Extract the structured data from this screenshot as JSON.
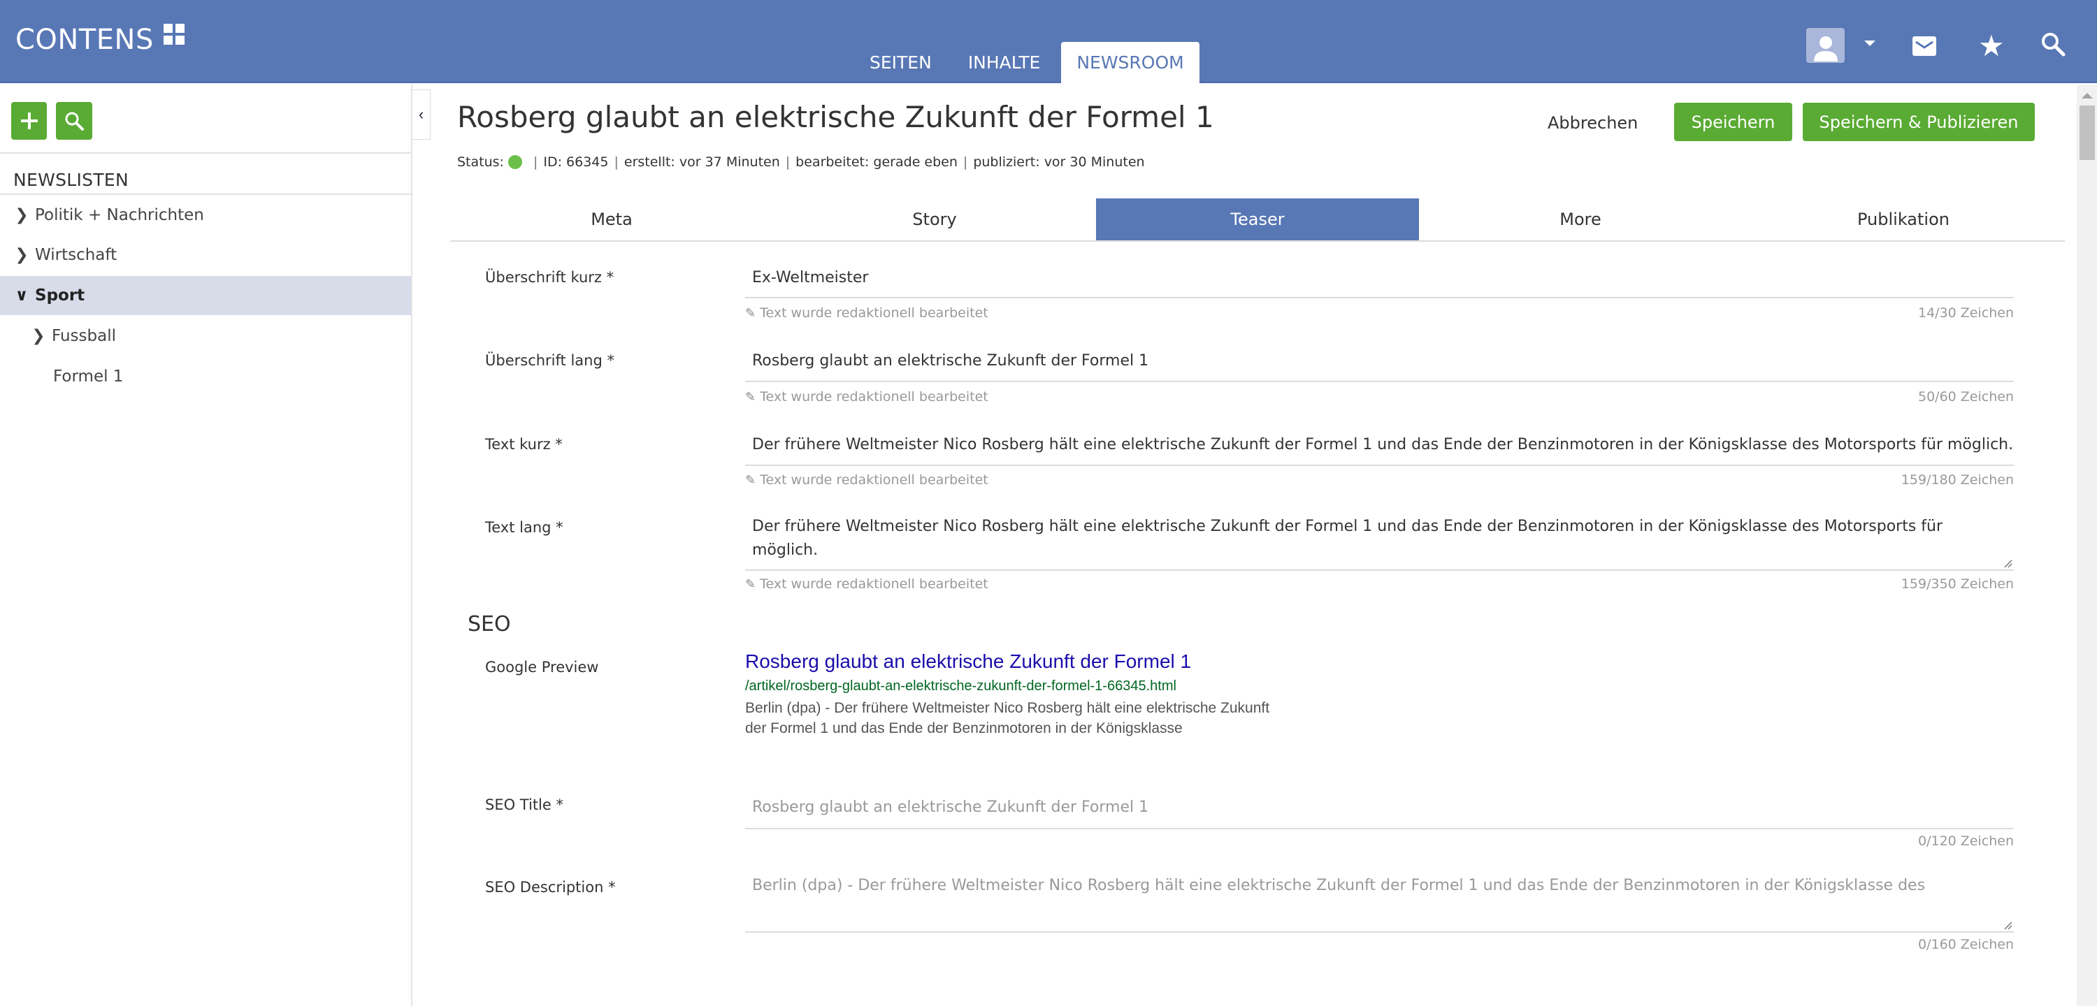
{
  "app": {
    "logo": "CONTENS",
    "main_tabs": [
      {
        "label": "SEITEN",
        "active": false
      },
      {
        "label": "INHALTE",
        "active": false
      },
      {
        "label": "NEWSROOM",
        "active": true
      }
    ],
    "icons": [
      "user-avatar-icon",
      "caret-down-icon",
      "mail-icon",
      "star-icon",
      "search-icon"
    ]
  },
  "sidebar": {
    "heading": "NEWSLISTEN",
    "items": [
      {
        "label": "Politik + Nachrichten",
        "icon": "chevron-right",
        "level": 0,
        "selected": false
      },
      {
        "label": "Wirtschaft",
        "icon": "chevron-right",
        "level": 0,
        "selected": false
      },
      {
        "label": "Sport",
        "icon": "chevron-down",
        "level": 0,
        "selected": true
      },
      {
        "label": "Fussball",
        "icon": "chevron-right",
        "level": 1,
        "selected": false
      },
      {
        "label": "Formel 1",
        "icon": "",
        "level": 1,
        "selected": false
      }
    ]
  },
  "article": {
    "title": "Rosberg glaubt an elektrische Zukunft der Formel 1",
    "status_label": "Status:",
    "status_color": "#6cc04a",
    "id": "ID: 66345",
    "created": "erstellt: vor 37 Minuten",
    "edited": "bearbeitet: gerade eben",
    "published": "publiziert: vor 30 Minuten"
  },
  "actions": {
    "cancel": "Abbrechen",
    "save": "Speichern",
    "save_publish": "Speichern & Publizieren"
  },
  "tabs": [
    {
      "label": "Meta",
      "active": false
    },
    {
      "label": "Story",
      "active": false
    },
    {
      "label": "Teaser",
      "active": true
    },
    {
      "label": "More",
      "active": false
    },
    {
      "label": "Publikation",
      "active": false
    }
  ],
  "fields": [
    {
      "label": "Überschrift kurz *",
      "value": "Ex-Weltmeister",
      "hint": "Text wurde redaktionell bearbeitet",
      "counter": "14/30 Zeichen"
    },
    {
      "label": "Überschrift lang *",
      "value": "Rosberg glaubt an elektrische Zukunft der Formel 1",
      "hint": "Text wurde redaktionell bearbeitet",
      "counter": "50/60 Zeichen"
    },
    {
      "label": "Text kurz *",
      "value": "Der frühere Weltmeister Nico Rosberg hält eine elektrische Zukunft der Formel 1 und das Ende der Benzinmotoren in der Königsklasse des Motorsports für möglich.",
      "hint": "Text wurde redaktionell bearbeitet",
      "counter": "159/180 Zeichen"
    },
    {
      "label": "Text lang *",
      "value": "Der frühere Weltmeister Nico Rosberg hält eine elektrische Zukunft der Formel 1 und das Ende der Benzinmotoren in der Königsklasse des Motorsports für möglich.",
      "hint": "Text wurde redaktionell bearbeitet",
      "counter": "159/350 Zeichen"
    }
  ],
  "seo": {
    "heading": "SEO",
    "google_preview_label": "Google Preview",
    "preview_title": "Rosberg glaubt an elektrische Zukunft der Formel 1",
    "preview_url": "/artikel/rosberg-glaubt-an-elektrische-zukunft-der-formel-1-66345.html",
    "preview_desc": "Berlin (dpa) - Der frühere Weltmeister Nico Rosberg hält eine elektrische Zukunft der Formel 1 und das Ende der Benzinmotoren in der Königsklasse",
    "title_label": "SEO Title *",
    "title_placeholder": "Rosberg glaubt an elektrische Zukunft der Formel 1",
    "title_counter": "0/120 Zeichen",
    "desc_label": "SEO Description *",
    "desc_placeholder": "Berlin (dpa) - Der frühere Weltmeister Nico Rosberg hält eine elektrische Zukunft der Formel 1 und das Ende der Benzinmotoren in der Königsklasse des",
    "desc_counter": "0/160 Zeichen"
  }
}
